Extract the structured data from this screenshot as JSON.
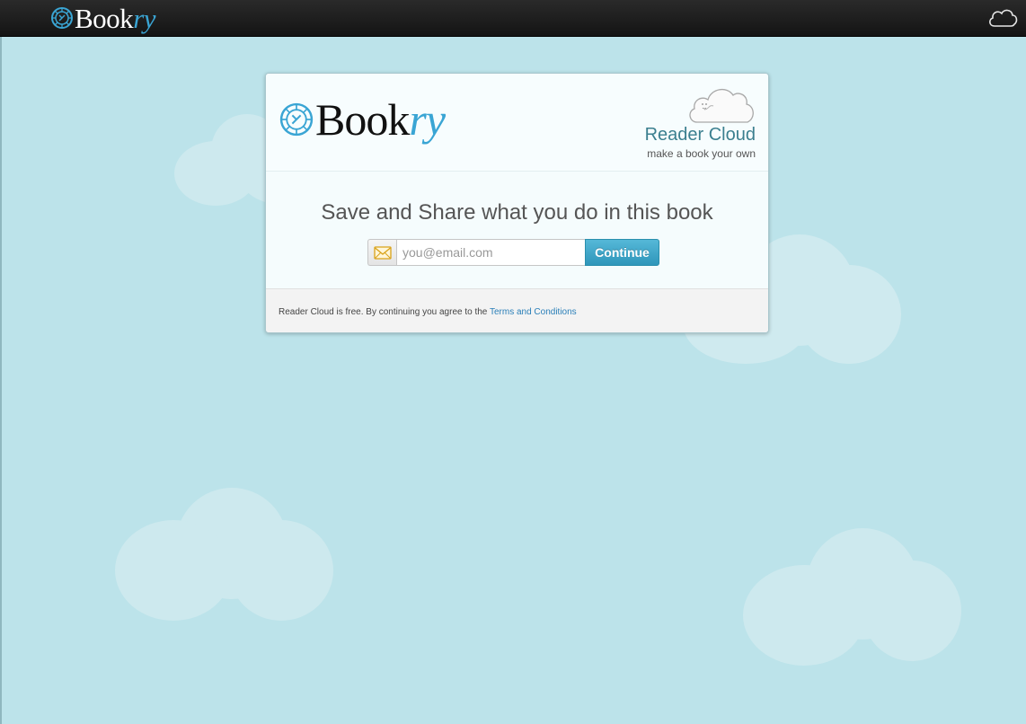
{
  "topbar": {
    "logo_book": "Book",
    "logo_ry": "ry",
    "logo_icon": "bookry-sun-icon",
    "cloud_icon": "cloud-icon"
  },
  "card": {
    "logo_book": "Book",
    "logo_ry": "ry",
    "reader_cloud_title": "Reader Cloud",
    "reader_cloud_subtitle": "make a book your own",
    "headline": "Save and Share what you do in this book",
    "email_placeholder": "you@email.com",
    "email_value": "",
    "continue_label": "Continue",
    "footer_text": "Reader Cloud is free. By continuing you agree to the ",
    "terms_link": "Terms and Conditions"
  },
  "colors": {
    "background": "#bce3ea",
    "topbar": "#1c1c1c",
    "accent_blue": "#3aa5d4",
    "button": "#3da4c6",
    "reader_cloud_text": "#3b7f8f"
  }
}
